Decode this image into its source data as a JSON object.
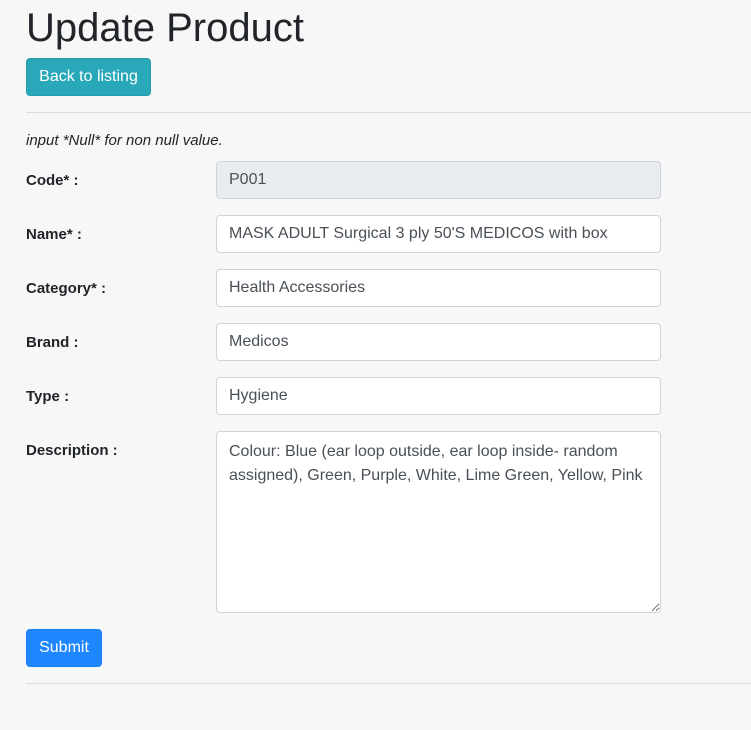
{
  "page": {
    "title": "Update Product",
    "back_button": "Back to listing",
    "note": "input *Null* for non null value."
  },
  "form": {
    "code": {
      "label": "Code* :",
      "value": "P001"
    },
    "name": {
      "label": "Name* :",
      "value": "MASK ADULT Surgical 3 ply 50'S MEDICOS with box"
    },
    "category": {
      "label": "Category* :",
      "value": "Health Accessories"
    },
    "brand": {
      "label": "Brand :",
      "value": "Medicos"
    },
    "type": {
      "label": "Type :",
      "value": "Hygiene"
    },
    "description": {
      "label": "Description :",
      "value": "Colour: Blue (ear loop outside, ear loop inside- random assigned), Green, Purple, White, Lime Green, Yellow, Pink"
    },
    "submit_label": "Submit"
  },
  "colors": {
    "back_button": "#28a8b8",
    "submit_button": "#1e86ff",
    "background": "#f7f7f7",
    "readonly_field": "#e9ecef"
  }
}
